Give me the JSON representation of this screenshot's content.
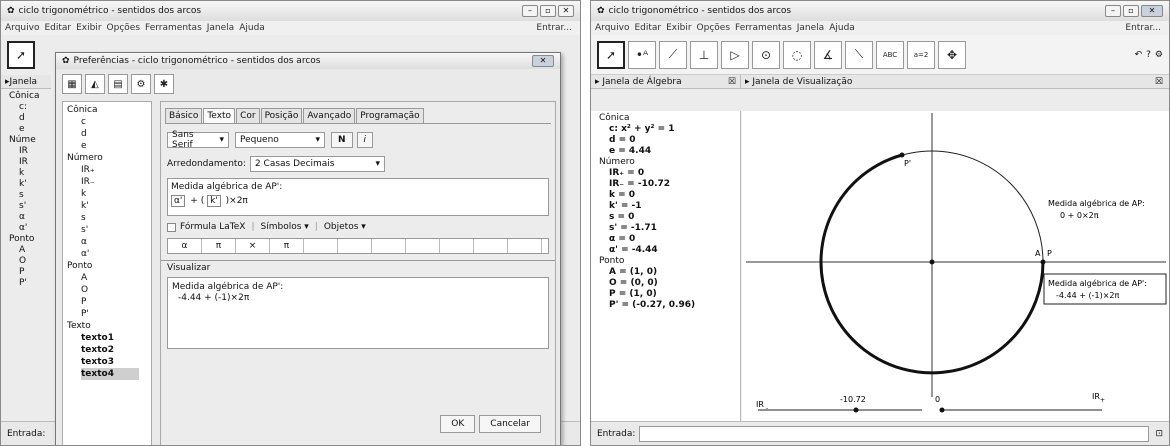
{
  "left": {
    "title": "ciclo trigonométrico - sentidos dos arcos",
    "menu": [
      "Arquivo",
      "Editar",
      "Exibir",
      "Opções",
      "Ferramentas",
      "Janela",
      "Ajuda"
    ],
    "menu_right": "Entrar...",
    "panel_label": "Janela",
    "tree": [
      "Cônica",
      "c:",
      "d",
      "e",
      "Núme",
      "IR",
      "IR",
      "k",
      "k'",
      "s",
      "s'",
      "α",
      "α'",
      "Ponto",
      "A",
      "O",
      "P",
      "P'"
    ],
    "input_label": "Entrada:"
  },
  "dialog": {
    "title": "Preferências - ciclo trigonométrico - sentidos dos arcos",
    "tree": [
      {
        "group": "Cônica",
        "items": [
          "c",
          "d",
          "e"
        ]
      },
      {
        "group": "Número",
        "items": [
          "IR₊",
          "IR₋",
          "k",
          "k'",
          "s",
          "s'",
          "α",
          "α'"
        ]
      },
      {
        "group": "Ponto",
        "items": [
          "A",
          "O",
          "P",
          "P'"
        ]
      },
      {
        "group": "Texto",
        "items": [
          "texto1",
          "texto2",
          "texto3",
          "texto4"
        ]
      }
    ],
    "selected_item": "texto4",
    "tabs": [
      "Básico",
      "Texto",
      "Cor",
      "Posição",
      "Avançado",
      "Programação"
    ],
    "active_tab": "Texto",
    "font_family": "Sans Serif",
    "font_size": "Pequeno",
    "bold_label": "N",
    "italic_label": "i",
    "rounding_label": "Arredondamento:",
    "rounding_value": "2 Casas Decimais",
    "edit_heading": "Medida algébrica de AP':",
    "edit_expr": {
      "a": "α'",
      "plus": "+ (",
      "k": "k'",
      "tail": ")×2π"
    },
    "latex_label": "Fórmula LaTeX",
    "symbols_label": "Símbolos",
    "objects_label": "Objetos",
    "symbols": [
      "α",
      "π",
      "×",
      "π",
      "",
      "",
      "",
      "",
      "",
      "",
      ""
    ],
    "preview_label": "Visualizar",
    "preview_heading": "Medida algébrica de AP':",
    "preview_value": "-4.44  + (-1)×2π",
    "ok": "OK",
    "cancel": "Cancelar"
  },
  "right": {
    "title": "ciclo trigonométrico - sentidos dos arcos",
    "menu": [
      "Arquivo",
      "Editar",
      "Exibir",
      "Opções",
      "Ferramentas",
      "Janela",
      "Ajuda"
    ],
    "menu_right": "Entrar...",
    "algebra_header": "Janela de Álgebra",
    "view_header": "Janela de Visualização",
    "algebra": [
      {
        "h": "Cônica"
      },
      {
        "t": "c: x² + y² = 1"
      },
      {
        "t": "d = 0"
      },
      {
        "t": "e = 4.44"
      },
      {
        "h": "Número"
      },
      {
        "t": "IR₊ = 0"
      },
      {
        "t": "IR₋ = -10.72"
      },
      {
        "t": "k = 0"
      },
      {
        "t": "k' = -1"
      },
      {
        "t": "s = 0"
      },
      {
        "t": "s' = -1.71"
      },
      {
        "t": "α = 0"
      },
      {
        "t": "α' = -4.44"
      },
      {
        "h": "Ponto"
      },
      {
        "t": "A = (1, 0)"
      },
      {
        "t": "O = (0, 0)"
      },
      {
        "t": "P = (1, 0)"
      },
      {
        "t": "P' = (-0.27, 0.96)"
      }
    ],
    "graph": {
      "label_Pprime": "P'",
      "label_A": "A",
      "label_P": "P",
      "text1_heading": "Medida algébrica de AP:",
      "text1_value": "0 + 0×2π",
      "text2_heading": "Medida algébrica de AP':",
      "text2_value": "-4.44  + (-1)×2π",
      "slider_neg_label": "IR",
      "slider_neg_sub": "-",
      "slider_neg_value": "-10.72",
      "slider_pos_value": "0",
      "slider_pos_label": "IR",
      "slider_pos_sub": "+"
    },
    "input_label": "Entrada:"
  }
}
